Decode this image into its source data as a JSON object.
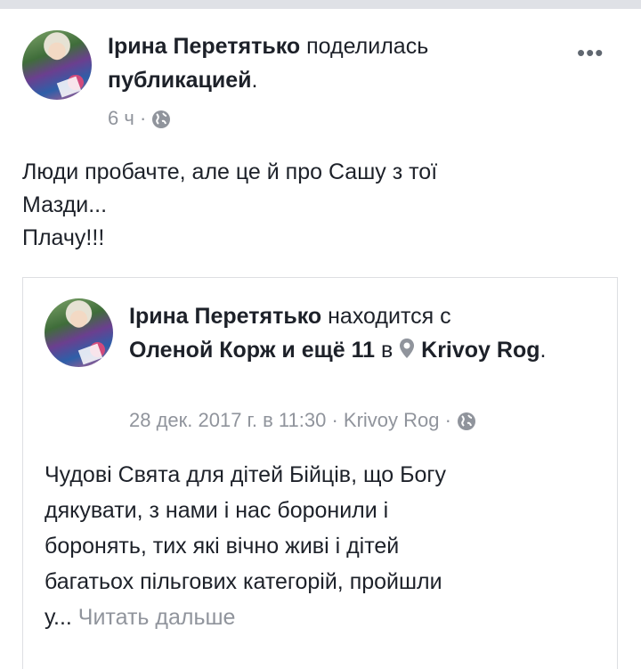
{
  "post": {
    "author": "Ірина Перетятько",
    "action": "поделилась",
    "action_object": "публикацией",
    "period": ".",
    "time": "6 ч",
    "separator": "·",
    "more_icon": "more-dots-icon",
    "text_line1": "Люди пробачте, але це й про Сашу з тої",
    "text_line2": "Мазди...",
    "text_line3": "Плачу!!!"
  },
  "shared": {
    "author": "Ірина Перетятько",
    "with_label": "находится с",
    "tagged_person": "Оленой Корж",
    "and_others": "и ещё 11",
    "in_label": "в",
    "location": "Krivoy Rog",
    "period": ".",
    "date": "28 дек. 2017 г. в 11:30",
    "location_meta": "Krivoy Rog",
    "separator": "·",
    "text_line1": "Чудові Свята для дітей Бійців, що Богу",
    "text_line2": "дякувати, з нами і нас боронили і",
    "text_line3": "боронять, тих які вічно живі і дітей",
    "text_line4": "багатьох пільгових категорій, пройшли",
    "text_line5": "у...",
    "see_more": "Читать дальше"
  },
  "colors": {
    "text": "#1d2129",
    "meta": "#90949c",
    "border": "#dddfe2"
  }
}
